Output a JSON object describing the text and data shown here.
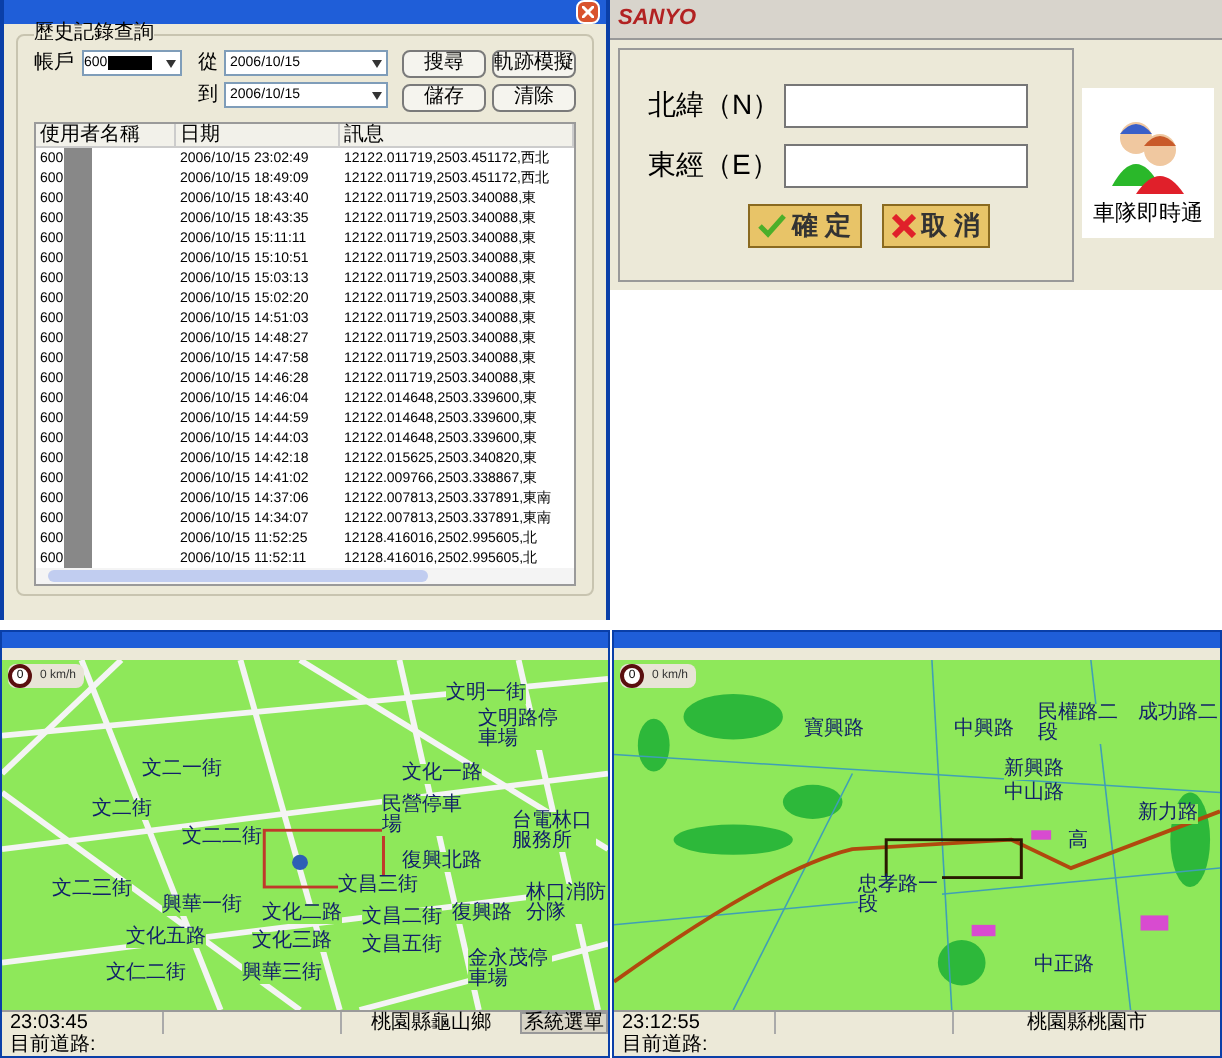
{
  "history_dialog": {
    "group_title": "歷史記錄查詢",
    "account_label": "帳戶",
    "account_value": "600",
    "from_label": "從",
    "from_date": "2006/10/15",
    "to_label": "到",
    "to_date": "2006/10/15",
    "buttons": [
      "搜尋",
      "軌跡模擬",
      "儲存",
      "清除"
    ],
    "table": {
      "columns": [
        "使用者名稱",
        "日期",
        "訊息"
      ],
      "rows": [
        {
          "user": "600",
          "date": "2006/10/15 23:02:49",
          "message": "12122.011719,2503.451172,西北"
        },
        {
          "user": "600",
          "date": "2006/10/15 18:49:09",
          "message": "12122.011719,2503.451172,西北"
        },
        {
          "user": "600",
          "date": "2006/10/15 18:43:40",
          "message": "12122.011719,2503.340088,東"
        },
        {
          "user": "600",
          "date": "2006/10/15 18:43:35",
          "message": "12122.011719,2503.340088,東"
        },
        {
          "user": "600",
          "date": "2006/10/15 15:11:11",
          "message": "12122.011719,2503.340088,東"
        },
        {
          "user": "600",
          "date": "2006/10/15 15:10:51",
          "message": "12122.011719,2503.340088,東"
        },
        {
          "user": "600",
          "date": "2006/10/15 15:03:13",
          "message": "12122.011719,2503.340088,東"
        },
        {
          "user": "600",
          "date": "2006/10/15 15:02:20",
          "message": "12122.011719,2503.340088,東"
        },
        {
          "user": "600",
          "date": "2006/10/15 14:51:03",
          "message": "12122.011719,2503.340088,東"
        },
        {
          "user": "600",
          "date": "2006/10/15 14:48:27",
          "message": "12122.011719,2503.340088,東"
        },
        {
          "user": "600",
          "date": "2006/10/15 14:47:58",
          "message": "12122.011719,2503.340088,東"
        },
        {
          "user": "600",
          "date": "2006/10/15 14:46:28",
          "message": "12122.011719,2503.340088,東"
        },
        {
          "user": "600",
          "date": "2006/10/15 14:46:04",
          "message": "12122.014648,2503.339600,東"
        },
        {
          "user": "600",
          "date": "2006/10/15 14:44:59",
          "message": "12122.014648,2503.339600,東"
        },
        {
          "user": "600",
          "date": "2006/10/15 14:44:03",
          "message": "12122.014648,2503.339600,東"
        },
        {
          "user": "600",
          "date": "2006/10/15 14:42:18",
          "message": "12122.015625,2503.340820,東"
        },
        {
          "user": "600",
          "date": "2006/10/15 14:41:02",
          "message": "12122.009766,2503.338867,東"
        },
        {
          "user": "600",
          "date": "2006/10/15 14:37:06",
          "message": "12122.007813,2503.337891,東南"
        },
        {
          "user": "600",
          "date": "2006/10/15 14:34:07",
          "message": "12122.007813,2503.337891,東南"
        },
        {
          "user": "600",
          "date": "2006/10/15 11:52:25",
          "message": "12128.416016,2502.995605,北"
        },
        {
          "user": "600",
          "date": "2006/10/15 11:52:11",
          "message": "12128.416016,2502.995605,北"
        }
      ]
    }
  },
  "coordinate_dialog": {
    "brand": "SANYO",
    "fields": [
      {
        "label": "北緯（N）"
      },
      {
        "label": "東經（E）"
      }
    ],
    "buttons": [
      {
        "label": "確 定",
        "kind": "ok"
      },
      {
        "label": "取 消",
        "kind": "cancel"
      }
    ],
    "fleet_button": "車隊即時通"
  },
  "maps": [
    {
      "kind": "street",
      "speed": "0",
      "speed_text": "0 km/h",
      "time": "23:03:45",
      "location": "桃園縣龜山鄉",
      "menu_button": "系統選單",
      "road_label": "目前道路:",
      "labels": [
        "文明一街",
        "文明路停車場",
        "文化一路",
        "文二一街",
        "文二街",
        "民營停車場",
        "文二二街",
        "復興北路",
        "台電林口服務所",
        "文二三街",
        "林口消防分隊",
        "文昌三街",
        "興華一街",
        "文化二路",
        "文昌二街",
        "復興路",
        "文化五路",
        "文化三路",
        "文昌五街",
        "文仁二街",
        "興華三街",
        "金永茂停車場"
      ]
    },
    {
      "kind": "region",
      "speed": "0",
      "speed_text": "0 km/h",
      "time": "23:12:55",
      "location": "桃園縣桃園市",
      "road_label": "目前道路:",
      "labels": [
        "寶興路",
        "中興路",
        "民權路二段",
        "成功路二",
        "新興路",
        "中山路",
        "新力路",
        "高",
        "忠孝路一段",
        "中正路"
      ]
    }
  ]
}
